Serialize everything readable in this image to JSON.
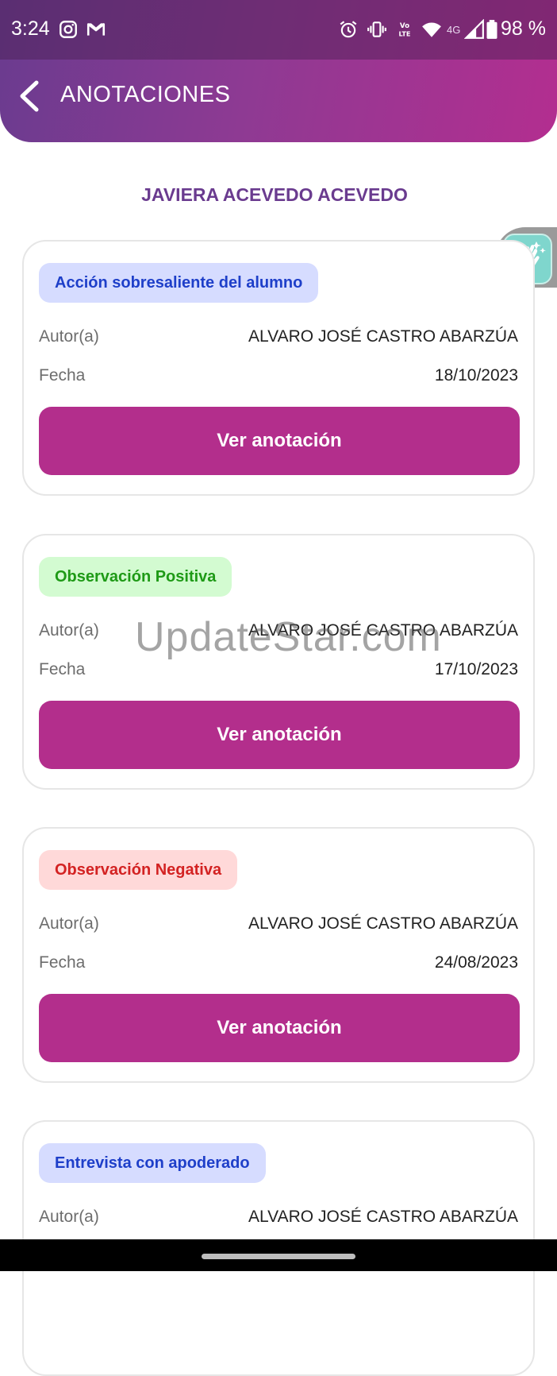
{
  "status_bar": {
    "time": "3:24",
    "battery": "98 %",
    "network_label": "4G",
    "icons": [
      "instagram-icon",
      "gmail-icon",
      "alarm-icon",
      "vibrate-icon",
      "volte-icon",
      "wifi-icon",
      "signal-icon",
      "battery-icon"
    ]
  },
  "app_bar": {
    "title": "ANOTACIONES",
    "back_icon": "chevron-left-icon"
  },
  "student": {
    "name": "JAVIERA ACEVEDO ACEVEDO"
  },
  "cards": [
    {
      "category": "Acción sobresaliente del alumno",
      "category_color": "#1e3fc9",
      "category_bg": "#d6dcff",
      "author_label": "Autor(a)",
      "author": "ALVARO JOSÉ CASTRO ABARZÚA",
      "date_label": "Fecha",
      "date": "18/10/2023",
      "button_label": "Ver anotación"
    },
    {
      "category": "Observación Positiva",
      "category_color": "#1e9a16",
      "category_bg": "#d3fbd1",
      "author_label": "Autor(a)",
      "author": "ALVARO JOSÉ CASTRO ABARZÚA",
      "date_label": "Fecha",
      "date": "17/10/2023",
      "button_label": "Ver anotación"
    },
    {
      "category": "Observación Negativa",
      "category_color": "#d32222",
      "category_bg": "#ffd9d9",
      "author_label": "Autor(a)",
      "author": "ALVARO JOSÉ CASTRO ABARZÚA",
      "date_label": "Fecha",
      "date": "24/08/2023",
      "button_label": "Ver anotación"
    },
    {
      "category": "Entrevista con apoderado",
      "category_color": "#1e3fc9",
      "category_bg": "#d6dcff",
      "author_label": "Autor(a)",
      "author": "ALVARO JOSÉ CASTRO ABARZÚA"
    }
  ],
  "floating_button": {
    "icon": "waving-hand-icon"
  },
  "watermark": "UpdateStar.com",
  "colors": {
    "accent": "#b32e8c",
    "header_start": "#6a3b8f",
    "header_end": "#b32e90",
    "title": "#6a3b8f"
  }
}
